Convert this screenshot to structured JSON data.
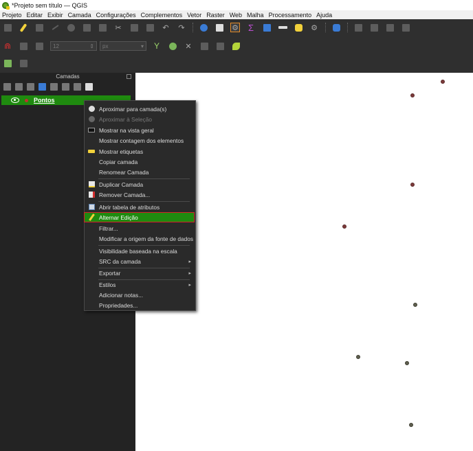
{
  "window": {
    "title": "*Projeto sem título — QGIS"
  },
  "menubar": [
    "Projeto",
    "Editar",
    "Exibir",
    "Camada",
    "Configurações",
    "Complementos",
    "Vetor",
    "Raster",
    "Web",
    "Malha",
    "Processamento",
    "Ajuda"
  ],
  "toolbar": {
    "snap_tolerance_value": "12",
    "snap_units": "px"
  },
  "layers_panel": {
    "title": "Camadas",
    "layer": {
      "name": "Pontos",
      "symbol_color": "#c03030"
    }
  },
  "context_menu": {
    "items": [
      {
        "label": "Aproximar para camada(s)",
        "icon": "zoom-to-layer-icon",
        "disabled": false
      },
      {
        "label": "Aproximar à Seleção",
        "icon": "zoom-to-selection-icon",
        "disabled": true
      },
      {
        "label": "Mostrar na vista geral",
        "icon": "overview-icon",
        "disabled": false
      },
      {
        "label": "Mostrar contagem dos elementos",
        "icon": "",
        "disabled": false
      },
      {
        "label": "Mostrar etiquetas",
        "icon": "labels-icon",
        "disabled": false
      },
      {
        "label": "Copiar camada",
        "icon": "",
        "disabled": false
      },
      {
        "label": "Renomear Camada",
        "icon": "",
        "disabled": false
      },
      {
        "label": "Duplicar Camada",
        "icon": "duplicate-layer-icon",
        "disabled": false
      },
      {
        "label": "Remover Camada...",
        "icon": "remove-layer-icon",
        "disabled": false
      },
      {
        "label": "Abrir tabela de atributos",
        "icon": "attribute-table-icon",
        "disabled": false
      },
      {
        "label": "Alternar Edição",
        "icon": "pencil-icon",
        "disabled": false,
        "highlighted": true
      },
      {
        "label": "Filtrar...",
        "icon": "",
        "disabled": false
      },
      {
        "label": "Modificar a origem da fonte de dados",
        "icon": "",
        "disabled": false
      },
      {
        "label": "Visibilidade baseada na escala",
        "icon": "",
        "disabled": false
      },
      {
        "label": "SRC da camada",
        "icon": "",
        "disabled": false,
        "submenu": true
      },
      {
        "label": "Exportar",
        "icon": "",
        "disabled": false,
        "submenu": true
      },
      {
        "label": "Estilos",
        "icon": "",
        "disabled": false,
        "submenu": true
      },
      {
        "label": "Adicionar notas...",
        "icon": "",
        "disabled": false
      },
      {
        "label": "Propriedades...",
        "icon": "",
        "disabled": false
      }
    ]
  },
  "colors": {
    "highlight_green": "#1f8a0f",
    "highlight_border": "#d4202a",
    "point_fill": "#7d3a3a"
  }
}
